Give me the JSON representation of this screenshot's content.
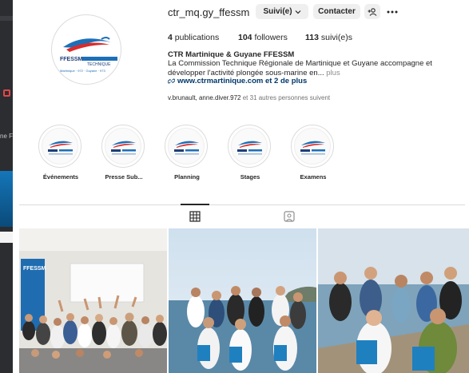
{
  "background_window": {
    "partial_text": "ne F"
  },
  "profile": {
    "username": "ctr_mq.gy_ffessm",
    "follow_button": "Suivi(e)",
    "contact_button": "Contacter",
    "stats": {
      "posts_count": "4",
      "posts_label": "publications",
      "followers_count": "104",
      "followers_label": "followers",
      "following_count": "113",
      "following_label": "suivi(e)s"
    },
    "display_name": "CTR Martinique & Guyane FFESSM",
    "bio": "La Commission Technique Régionale de Martinique et Guyane accompagne et développer l'activité plongée sous-marine en...",
    "bio_more": "plus",
    "link": "www.ctrmartinique.com et 2 de plus",
    "followed_by_names": "v.brunault, anne.diver.972",
    "followed_by_rest": "et 31 autres personnes suivent"
  },
  "logo": {
    "brand": "FFESSM",
    "sub": "TECHNIQUE",
    "regions": "Martinique · 972 · Guyane · 973"
  },
  "highlights": [
    {
      "label": "Événements"
    },
    {
      "label": "Presse Sub..."
    },
    {
      "label": "Planning"
    },
    {
      "label": "Stages"
    },
    {
      "label": "Examens"
    }
  ],
  "colors": {
    "accent_blue": "#1d6fb8",
    "accent_red": "#d92b2b",
    "link": "#00376b",
    "button_bg": "#efefef"
  },
  "icons": {
    "follow_chevron": "chevron-down-icon",
    "add_user": "add-user-icon",
    "more": "more-icon",
    "link": "link-icon",
    "tab_posts": "grid-icon",
    "tab_tagged": "tagged-icon"
  }
}
